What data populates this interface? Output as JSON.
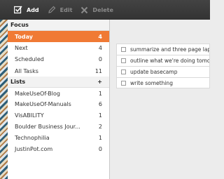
{
  "toolbar": {
    "add_label": "Add",
    "edit_label": "Edit",
    "delete_label": "Delete"
  },
  "focus": {
    "header": "Focus",
    "items": [
      {
        "label": "Today",
        "count": "4",
        "selected": true
      },
      {
        "label": "Next",
        "count": "4"
      },
      {
        "label": "Scheduled",
        "count": "0"
      },
      {
        "label": "All Tasks",
        "count": "11"
      }
    ]
  },
  "lists": {
    "header": "Lists",
    "add_symbol": "+",
    "items": [
      {
        "label": "MakeUseOf-Blog",
        "count": "1"
      },
      {
        "label": "MakeUseOf-Manuals",
        "count": "6"
      },
      {
        "label": "VisABILITY",
        "count": "1"
      },
      {
        "label": "Boulder Business Jour...",
        "count": "2"
      },
      {
        "label": "Technophilia",
        "count": "1"
      },
      {
        "label": "JustinPot.com",
        "count": "0"
      }
    ]
  },
  "tasks": [
    {
      "text": "summarize and three page laptop"
    },
    {
      "text": "outline what we're doing tomorrow"
    },
    {
      "text": "update basecamp"
    },
    {
      "text": "write something"
    }
  ],
  "colors": {
    "toolbar_bg": "#3a3a3a",
    "selected_bg": "#f07a35",
    "pane_bg": "#ececec"
  }
}
